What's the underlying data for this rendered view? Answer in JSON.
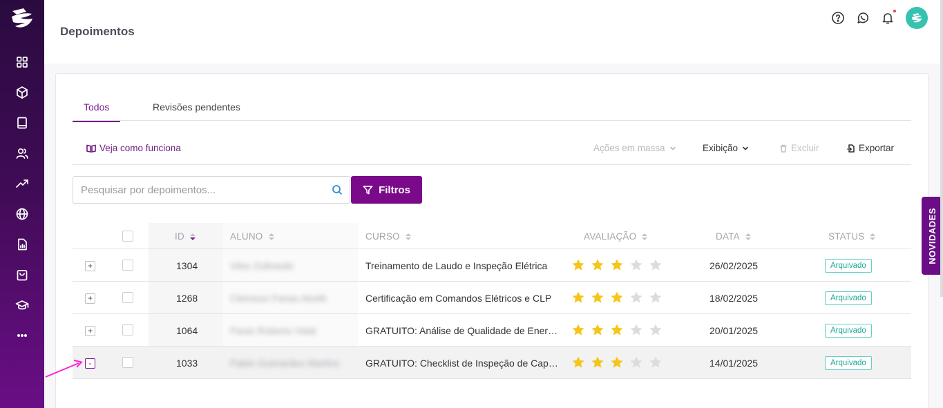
{
  "page": {
    "title": "Depoimentos"
  },
  "header": {
    "icons": [
      "help-icon",
      "whatsapp-icon",
      "bell-icon",
      "avatar-logo-icon"
    ]
  },
  "sidebar": {
    "items": [
      {
        "icon": "dashboard-grid-icon"
      },
      {
        "icon": "box-icon"
      },
      {
        "icon": "book-icon"
      },
      {
        "icon": "users-icon"
      },
      {
        "icon": "trending-up-icon"
      },
      {
        "icon": "globe-icon"
      },
      {
        "icon": "report-icon"
      },
      {
        "icon": "shopping-bag-icon"
      },
      {
        "icon": "graduation-cap-icon"
      },
      {
        "icon": "more-icon"
      }
    ]
  },
  "tabs": [
    {
      "label": "Todos",
      "active": true
    },
    {
      "label": "Revisões pendentes",
      "active": false
    }
  ],
  "toolbar": {
    "how_label": "Veja como funciona",
    "mass_label": "Ações em massa",
    "view_label": "Exibição",
    "delete_label": "Excluir",
    "export_label": "Exportar"
  },
  "search": {
    "placeholder": "Pesquisar por depoimentos..."
  },
  "filter": {
    "label": "Filtros"
  },
  "table": {
    "headers": {
      "id": "ID",
      "aluno": "ALUNO",
      "curso": "CURSO",
      "avaliacao": "AVALIAÇÃO",
      "data": "DATA",
      "status": "STATUS"
    },
    "rows": [
      {
        "expand": "+",
        "id": "1304",
        "aluno": "Vilso Zollowski",
        "curso": "Treinamento de Laudo e Inspeção Elétrica",
        "rating": 3,
        "data": "26/02/2025",
        "status": "Arquivado"
      },
      {
        "expand": "+",
        "id": "1268",
        "aluno": "Cleivison Farias Atreth",
        "curso": "Certificação em Comandos Elétricos e CLP",
        "rating": 3,
        "data": "18/02/2025",
        "status": "Arquivado"
      },
      {
        "expand": "+",
        "id": "1064",
        "aluno": "Paulo Roberto Vidal",
        "curso": "GRATUITO: Análise de Qualidade de Energ...",
        "rating": 3,
        "data": "20/01/2025",
        "status": "Arquivado"
      },
      {
        "expand": "-",
        "id": "1033",
        "aluno": "Pablo Guimarães Martins",
        "curso": "GRATUITO: Checklist de Inspeção de Capa...",
        "rating": 3,
        "data": "14/01/2025",
        "status": "Arquivado"
      }
    ]
  },
  "side_tab": {
    "label": "NOVIDADES"
  },
  "colors": {
    "brand": "#7b0a8a",
    "star_on": "#f5c518",
    "star_off": "#dcdcdc",
    "status": "#1ea897"
  }
}
